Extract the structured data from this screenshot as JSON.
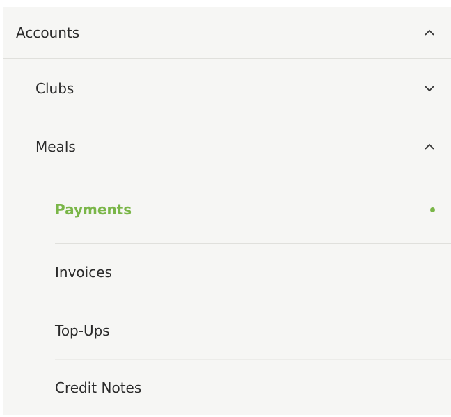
{
  "menu": {
    "accounts": {
      "label": "Accounts",
      "expanded": true
    },
    "clubs": {
      "label": "Clubs",
      "expanded": false
    },
    "meals": {
      "label": "Meals",
      "expanded": true
    },
    "payments": {
      "label": "Payments",
      "active": true
    },
    "invoices": {
      "label": "Invoices"
    },
    "topups": {
      "label": "Top-Ups"
    },
    "credit_notes": {
      "label": "Credit Notes"
    }
  },
  "icons": {
    "expanded": "chevron-up-icon",
    "collapsed": "chevron-down-icon",
    "active": "active-dot-icon"
  },
  "colors": {
    "panel_background": "#f6f6f4",
    "text": "#2b2b2b",
    "active": "#7ab648",
    "divider": "#e0e0dc"
  }
}
